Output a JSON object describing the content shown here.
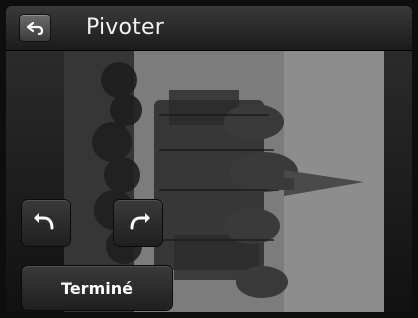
{
  "header": {
    "title": "Pivoter",
    "back_icon": "back-arrow-icon"
  },
  "controls": {
    "rotate_left_icon": "rotate-counterclockwise-icon",
    "rotate_right_icon": "rotate-clockwise-icon",
    "done_label": "Terminé"
  },
  "image": {
    "content": "photo"
  }
}
